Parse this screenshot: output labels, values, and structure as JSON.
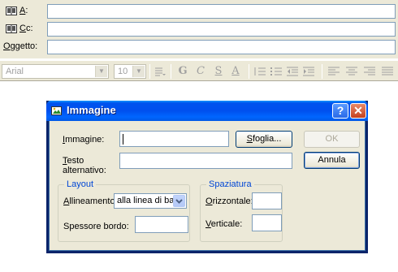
{
  "compose": {
    "to_label_prefix": "A",
    "to_label_suffix": ":",
    "cc_label_prefix": "C",
    "cc_label_suffix": "c:",
    "subject_label_prefix": "O",
    "subject_label_suffix": "ggetto:",
    "to_value": "",
    "cc_value": "",
    "subject_value": ""
  },
  "toolbar": {
    "font_name": "Arial",
    "font_size": "10",
    "bold": "G",
    "italic": "C",
    "underline": "S",
    "font_color": "A"
  },
  "dialog": {
    "title": "Immagine",
    "help_glyph": "?",
    "close_glyph": "✕",
    "image_label_prefix": "I",
    "image_label_suffix": "mmagine:",
    "image_value": "",
    "browse_prefix": "S",
    "browse_suffix": "foglia...",
    "alt_label_prefix": "T",
    "alt_label_suffix": "esto",
    "alt_label_line2": "alternativo:",
    "alt_value": "",
    "ok_label": "OK",
    "cancel_label": "Annula",
    "layout_group": "Layout",
    "align_label_prefix": "A",
    "align_label_suffix": "llineamento:",
    "align_value": "alla linea di base",
    "border_label": "Spessore bordo:",
    "border_value": "",
    "spacing_group": "Spaziatura",
    "horizontal_prefix": "O",
    "horizontal_suffix": "rizzontale:",
    "horizontal_value": "",
    "vertical_prefix": "V",
    "vertical_suffix": "erticale:",
    "vertical_value": ""
  }
}
